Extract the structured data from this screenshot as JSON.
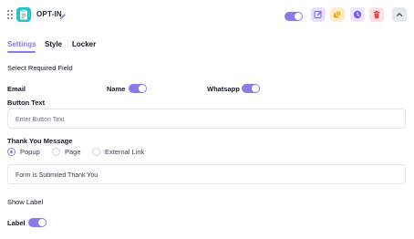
{
  "header": {
    "title": "OPT-IN",
    "toggle_on": true,
    "icons": [
      "drag-handle-icon",
      "clipboard-icon",
      "pencil-icon",
      "edit-icon",
      "duplicate-icon",
      "history-icon",
      "trash-icon",
      "chevron-up-icon"
    ]
  },
  "tabs": [
    {
      "label": "Settings",
      "active": true
    },
    {
      "label": "Style",
      "active": false
    },
    {
      "label": "Locker",
      "active": false
    }
  ],
  "required_fields": {
    "heading": "Select Required Field",
    "email_label": "Email",
    "name_label": "Name",
    "name_on": true,
    "whatsapp_label": "Whatsapp",
    "whatsapp_on": true
  },
  "button_text": {
    "label": "Button Text",
    "placeholder": "Enter Button Text",
    "value": ""
  },
  "thank_you": {
    "label": "Thank You Message",
    "options": [
      "Popup",
      "Page",
      "External Link"
    ],
    "selected": "Popup",
    "message_value": "Form Is Submited Thank You"
  },
  "show_label": {
    "heading": "Show Label",
    "label_text": "Label",
    "label_on": true
  },
  "colors": {
    "accent": "#8b7ae8",
    "app_icon": "#22c3d3",
    "edit_bg": "#e8e1ff",
    "duplicate_bg": "#fdebd0",
    "history_bg": "#ece6ff",
    "delete_bg": "#fde0e0"
  }
}
